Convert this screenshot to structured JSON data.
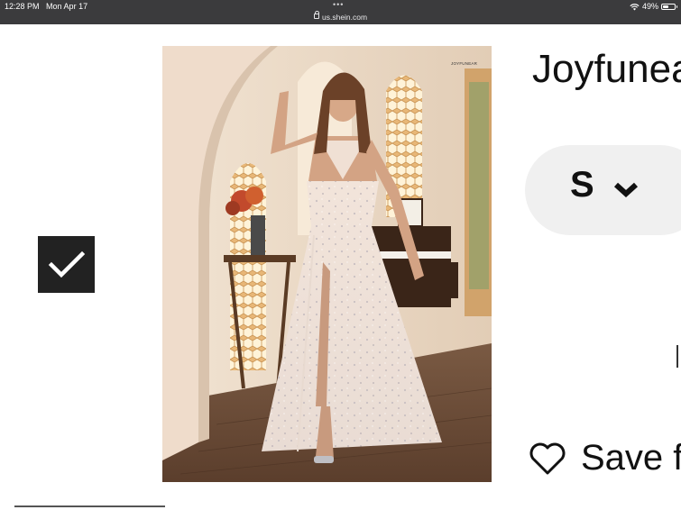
{
  "status_bar": {
    "time": "12:28 PM",
    "date": "Mon Apr 17",
    "url": "us.shein.com",
    "battery": "49%",
    "battery_level": 0.49,
    "dots": "•••"
  },
  "product": {
    "image_brand_text": "JOYFUNEAR",
    "image_icon": "dress-photo",
    "title": "Joyfunea",
    "size_value": "S",
    "save_label": "Save f"
  },
  "icons": {
    "checkbox": "check-icon",
    "size_dropdown": "chevron-down-icon",
    "save": "heart-icon"
  },
  "colors": {
    "status_bar": "#3b3b3d",
    "checkbox": "#222222",
    "size_pill": "#f0f0f0",
    "text": "#111111"
  }
}
